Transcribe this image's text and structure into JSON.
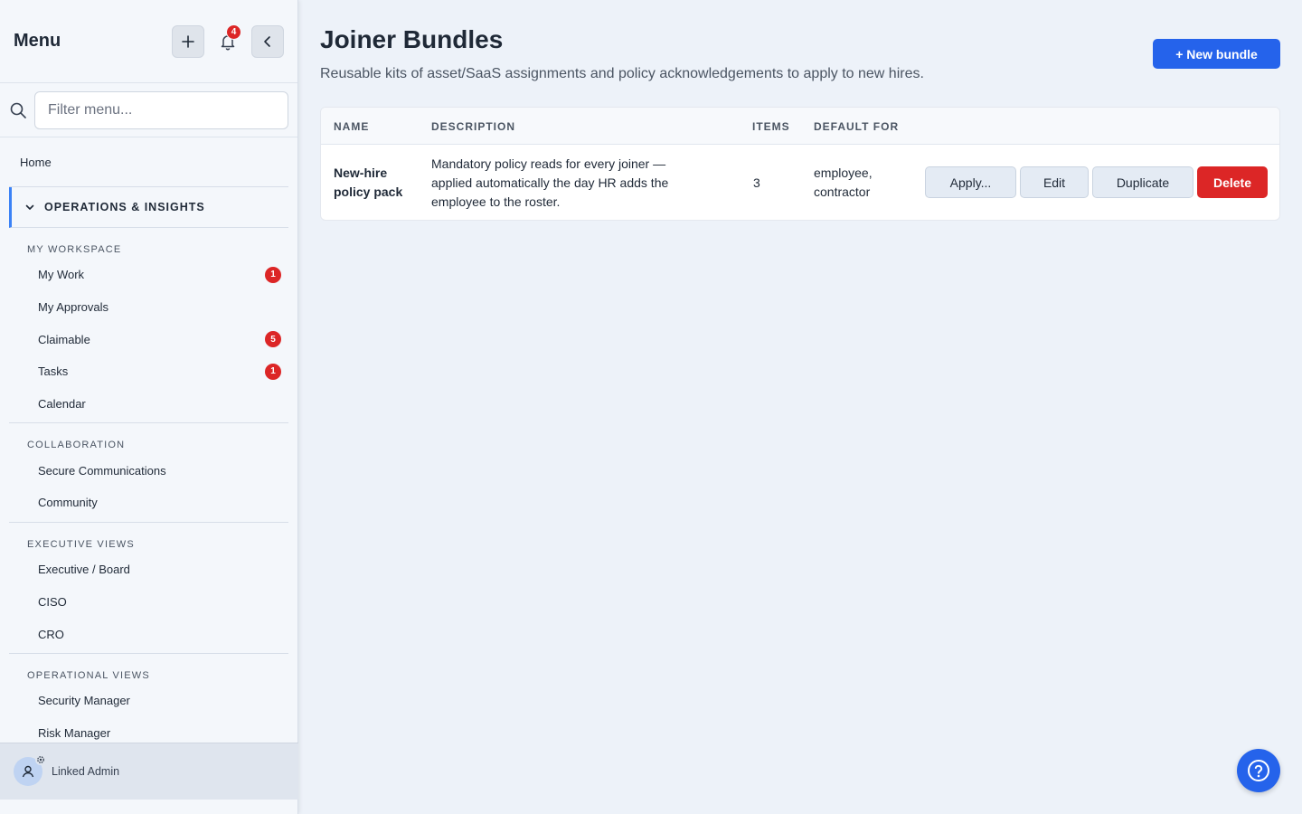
{
  "sidebar": {
    "title": "Menu",
    "notifications_count": "4",
    "filter_placeholder": "Filter menu...",
    "home_label": "Home",
    "section_label": "OPERATIONS & INSIGHTS",
    "groups": [
      {
        "title": "MY WORKSPACE",
        "items": [
          {
            "label": "My Work",
            "badge": "1"
          },
          {
            "label": "My Approvals",
            "badge": ""
          },
          {
            "label": "Claimable",
            "badge": "5"
          },
          {
            "label": "Tasks",
            "badge": "1"
          },
          {
            "label": "Calendar",
            "badge": ""
          }
        ]
      },
      {
        "title": "COLLABORATION",
        "items": [
          {
            "label": "Secure Communications",
            "badge": ""
          },
          {
            "label": "Community",
            "badge": ""
          }
        ]
      },
      {
        "title": "EXECUTIVE VIEWS",
        "items": [
          {
            "label": "Executive / Board",
            "badge": ""
          },
          {
            "label": "CISO",
            "badge": ""
          },
          {
            "label": "CRO",
            "badge": ""
          }
        ]
      },
      {
        "title": "OPERATIONAL VIEWS",
        "items": [
          {
            "label": "Security Manager",
            "badge": ""
          },
          {
            "label": "Risk Manager",
            "badge": ""
          }
        ]
      }
    ],
    "footer_user": "Linked Admin"
  },
  "main": {
    "title": "Joiner Bundles",
    "subtitle": "Reusable kits of asset/SaaS assignments and policy acknowledgements to apply to new hires.",
    "new_button": "+ New bundle",
    "table": {
      "headers": [
        "NAME",
        "DESCRIPTION",
        "ITEMS",
        "DEFAULT FOR"
      ],
      "rows": [
        {
          "name": "New-hire policy pack",
          "description": "Mandatory policy reads for every joiner — applied automatically the day HR adds the employee to the roster.",
          "items": "3",
          "default_for": "employee, contractor",
          "actions": {
            "apply": "Apply...",
            "edit": "Edit",
            "duplicate": "Duplicate",
            "delete": "Delete"
          }
        }
      ]
    }
  },
  "colors": {
    "accent": "#2563eb",
    "danger": "#dc2626",
    "section_marker": "#3b82f6"
  }
}
